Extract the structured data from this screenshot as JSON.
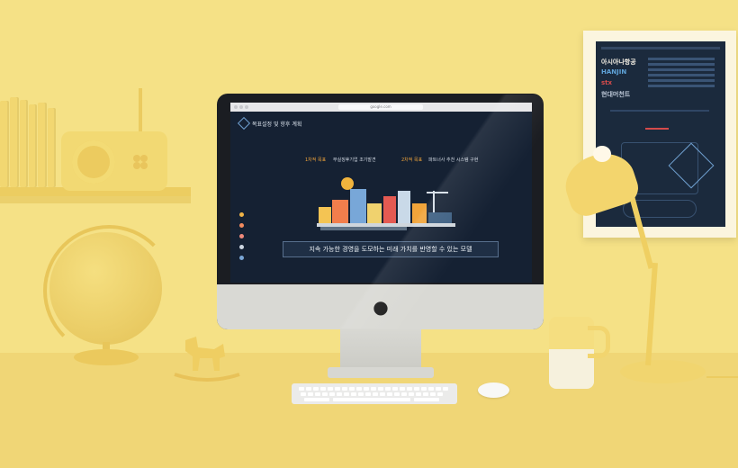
{
  "scene": {
    "colors": {
      "wall": "#f5e186",
      "desk": "#f0d676",
      "screen_bg": "#152133",
      "accent_orange": "#f1a43a",
      "accent_blue": "#6f9fcf"
    },
    "icons": [
      "apple-logo-icon",
      "sun-icon",
      "city-illustration-icon"
    ]
  },
  "screen": {
    "url": "google.com",
    "site_title": "목표설정 및 향후 계획",
    "goal1_label": "1차적 목표",
    "goal1_text": "부실징후기업 조기발견",
    "goal2_label": "2차적 목표",
    "goal2_text": "파트너사 추천 시스템 구현",
    "tagline": "지속 가능한 경영을 도모하는 미래 가치를 반영할 수 있는 모델"
  },
  "poster": {
    "logos": [
      "아시아나항공",
      "HANJIN",
      "stx",
      "현대머천트"
    ]
  }
}
